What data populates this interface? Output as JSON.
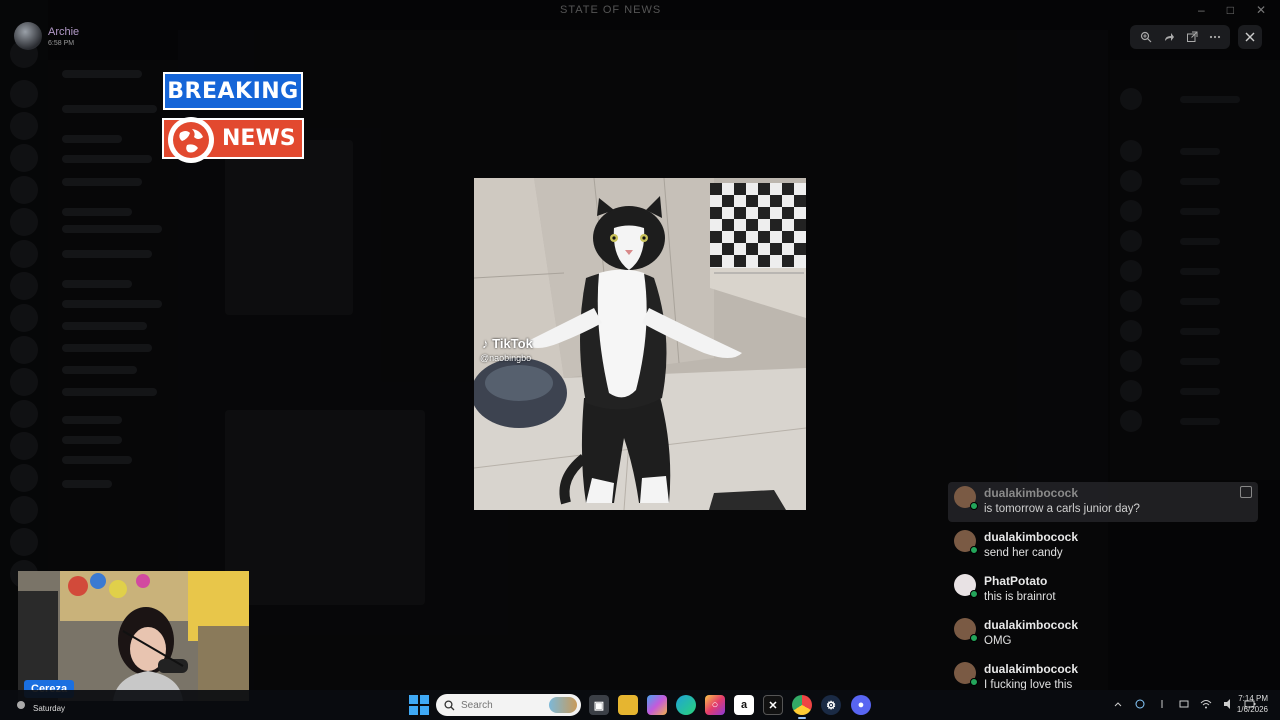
{
  "window": {
    "title": "STATE OF NEWS"
  },
  "user": {
    "name": "Archie",
    "time": "6:58 PM"
  },
  "banner": {
    "breaking": "BREAKING",
    "news": "NEWS"
  },
  "media": {
    "watermark": "TikTok",
    "handle": "@naobingbo"
  },
  "chat": {
    "messages": [
      {
        "user": "dualakimbocock",
        "text": "is tomorrow a carls junior day?",
        "avatar_color": "#7a5a44"
      },
      {
        "user": "dualakimbocock",
        "text": "send her candy",
        "avatar_color": "#7a5a44"
      },
      {
        "user": "PhatPotato",
        "text": "this is brainrot",
        "avatar_color": "#e8e2e4"
      },
      {
        "user": "dualakimbocock",
        "text": "OMG",
        "avatar_color": "#7a5a44"
      },
      {
        "user": "dualakimbocock",
        "text": "I fucking love this",
        "avatar_color": "#7a5a44"
      }
    ]
  },
  "webcam": {
    "label": "Cereza"
  },
  "taskbar": {
    "day": "Saturday",
    "search_placeholder": "Search",
    "clock_time": "7:14 PM",
    "clock_date": "1/6/2026",
    "apps": [
      "task-view",
      "file-explorer",
      "copilot",
      "edge",
      "instagram",
      "amazon",
      "x",
      "chrome",
      "steam",
      "discord"
    ]
  },
  "colors": {
    "breaking_bg": "#1565d8",
    "news_bg": "#e2492f",
    "webcam_tag": "#1a6fe0",
    "online": "#23a55a"
  }
}
